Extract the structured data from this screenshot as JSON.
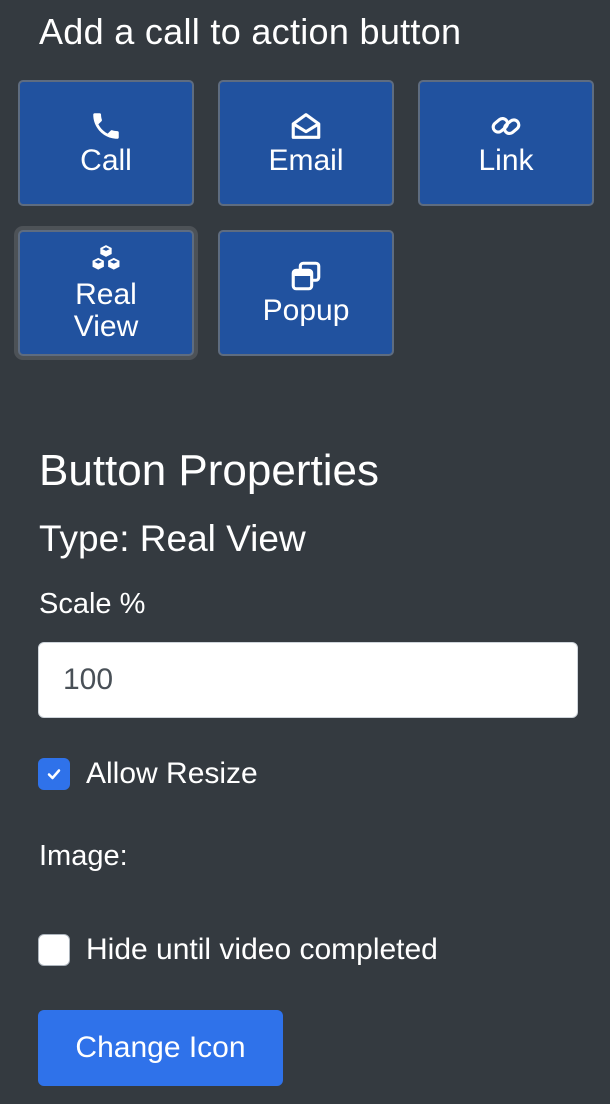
{
  "cta_section": {
    "heading": "Add a call to action button",
    "buttons": [
      {
        "label": "Call",
        "icon": "phone-icon",
        "selected": false
      },
      {
        "label": "Email",
        "icon": "envelope-open-icon",
        "selected": false
      },
      {
        "label": "Link",
        "icon": "link-icon",
        "selected": false
      },
      {
        "label": "Real\nView",
        "icon": "cubes-icon",
        "selected": true
      },
      {
        "label": "Popup",
        "icon": "window-restore-icon",
        "selected": false
      }
    ]
  },
  "properties": {
    "title": "Button Properties",
    "type_text": "Type: Real View",
    "scale_label": "Scale %",
    "scale_value": "100",
    "allow_resize_label": "Allow Resize",
    "allow_resize_checked": true,
    "image_label": "Image:",
    "hide_until_completed_label": "Hide until video completed",
    "hide_until_completed_checked": false,
    "change_icon_label": "Change Icon"
  },
  "colors": {
    "background": "#343a40",
    "cta_button": "#21529f",
    "primary": "#2f72ea"
  }
}
